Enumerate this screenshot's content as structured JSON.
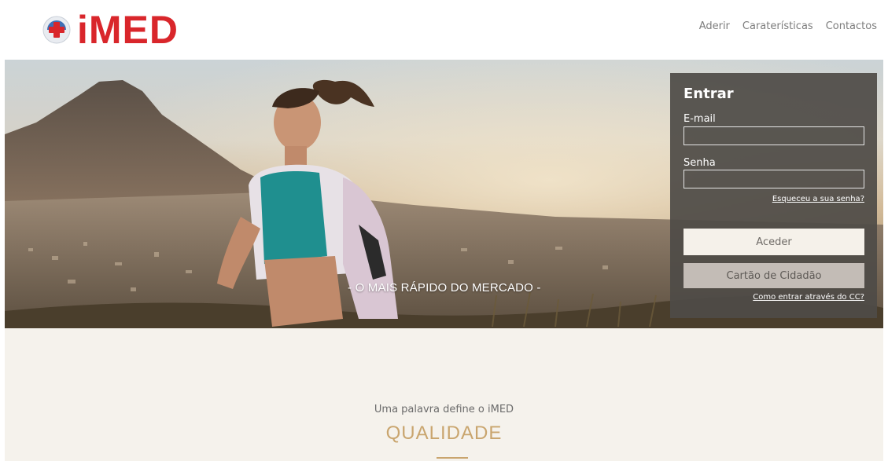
{
  "brand": {
    "name": "iMED",
    "color": "#d9262b"
  },
  "nav": {
    "items": [
      "Aderir",
      "Caraterísticas",
      "Contactos"
    ]
  },
  "hero": {
    "tagline": "- O MAIS RÁPIDO DO MERCADO -"
  },
  "login": {
    "title": "Entrar",
    "email_label": "E-mail",
    "email_value": "",
    "password_label": "Senha",
    "password_value": "",
    "forgot_link": "Esqueceu a sua senha?",
    "submit_label": "Aceder",
    "cc_button": "Cartão de Cidadão",
    "cc_help_link": "Como entrar através do CC?"
  },
  "section": {
    "subtitle": "Uma palavra define o iMED",
    "headline": "QUALIDADE",
    "accent": "#c9a56e"
  }
}
